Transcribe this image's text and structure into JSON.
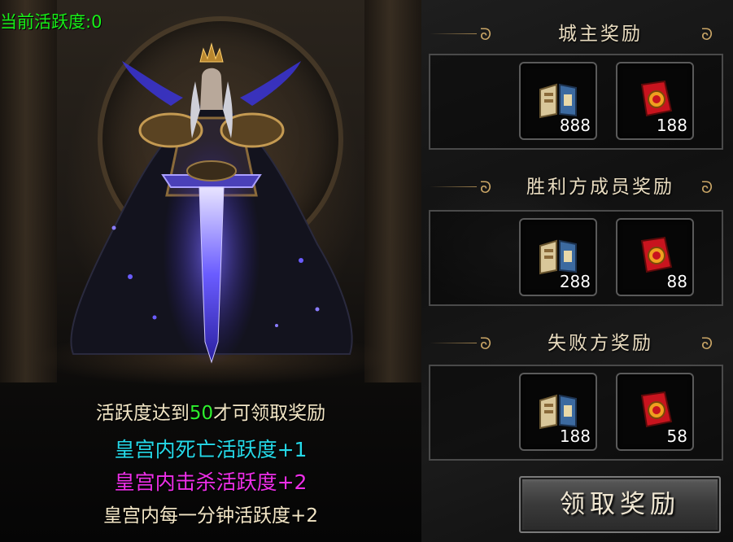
{
  "activity": {
    "label": "当前活跃度:0"
  },
  "rules": {
    "requirement_prefix": "活跃度达到",
    "requirement_value": "50",
    "requirement_suffix": "才可领取奖励",
    "death_line": "皇宫内死亡活跃度+1",
    "kill_line": "皇宫内击杀活跃度+2",
    "minute_line": "皇宫内每一分钟活跃度+2"
  },
  "sections": [
    {
      "title": "城主奖励",
      "items": [
        {
          "icon": "book-icon",
          "count": "888"
        },
        {
          "icon": "red-envelope-icon",
          "count": "188"
        }
      ]
    },
    {
      "title": "胜利方成员奖励",
      "items": [
        {
          "icon": "book-icon",
          "count": "288"
        },
        {
          "icon": "red-envelope-icon",
          "count": "88"
        }
      ]
    },
    {
      "title": "失败方奖励",
      "items": [
        {
          "icon": "book-icon",
          "count": "188"
        },
        {
          "icon": "red-envelope-icon",
          "count": "58"
        }
      ]
    }
  ],
  "claim_button": {
    "label": "领取奖励"
  },
  "colors": {
    "activity_green": "#18f018",
    "highlight_green": "#2ef02e",
    "death_cyan": "#25d9e8",
    "kill_magenta": "#ee2fe8",
    "header_gold": "#c9a566"
  }
}
